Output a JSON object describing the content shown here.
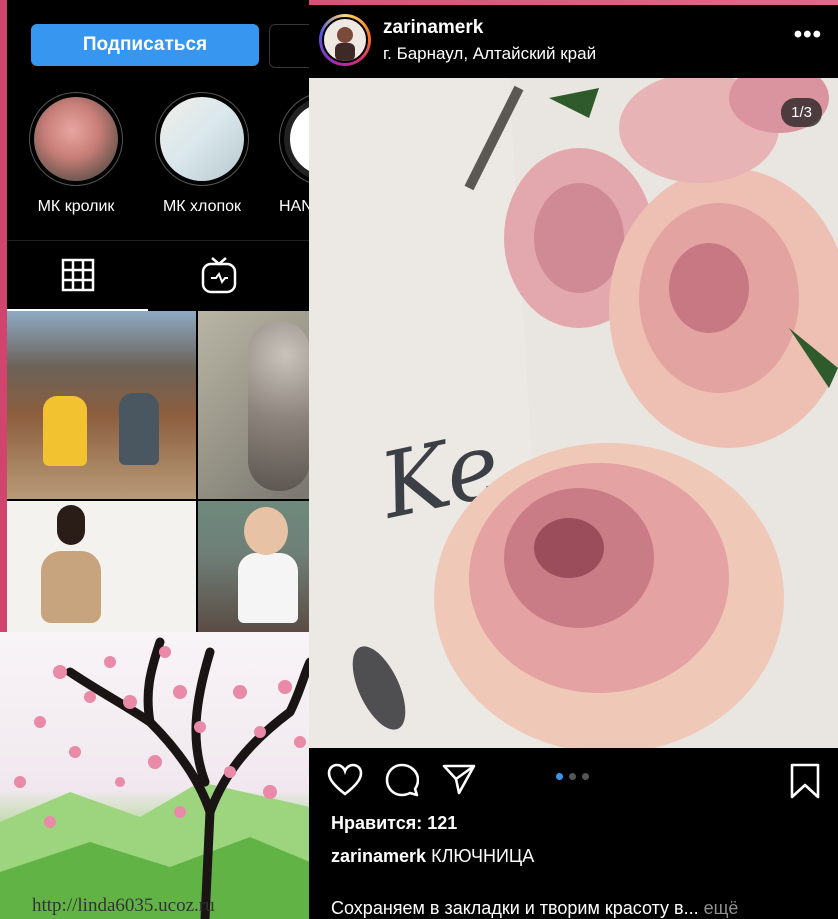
{
  "profile": {
    "follow_label": "Подписаться",
    "highlights": [
      {
        "label": "МК кролик"
      },
      {
        "label": "МК хлопок"
      },
      {
        "label": "HAN"
      }
    ],
    "tabs": [
      "grid-icon",
      "igtv-icon"
    ]
  },
  "background": {
    "url_text": "http://linda6035.ucoz.ru"
  },
  "post": {
    "username": "zarinamerk",
    "location": "г. Барнаул, Алтайский край",
    "more_label": "•••",
    "counter": "1/3",
    "likes_label": "Нравится: 121",
    "caption_user": "zarinamerk",
    "caption_text": "КЛЮЧНИЦА",
    "description": "Сохраняем в закладки и творим красоту в...",
    "more_link": "ещё",
    "carousel_dots": 3,
    "active_dot": 1,
    "accent": "#3797f0"
  }
}
